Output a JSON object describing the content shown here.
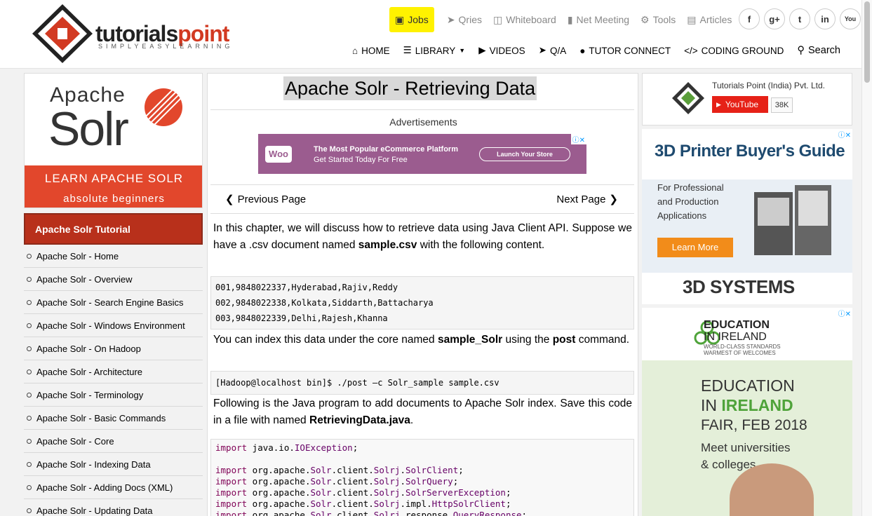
{
  "header": {
    "logo_word_a": "tutorials",
    "logo_word_b": "point",
    "logo_tagline": "SIMPLYEASYLEARNING",
    "top_links": {
      "jobs": "Jobs",
      "qries": "Qries",
      "whiteboard": "Whiteboard",
      "meeting": "Net Meeting",
      "tools": "Tools",
      "articles": "Articles"
    },
    "social": {
      "facebook": "f",
      "google": "g+",
      "twitter": "t",
      "linkedin": "in",
      "youtube": "You"
    },
    "nav": {
      "home": "HOME",
      "library": "LIBRARY",
      "videos": "VIDEOS",
      "qa": "Q/A",
      "tutor": "TUTOR CONNECT",
      "coding": "CODING GROUND",
      "search": "Search"
    }
  },
  "left": {
    "banner": {
      "apache": "Apache",
      "solr": "Solr",
      "learn": "LEARN APACHE SOLR",
      "absolute": "absolute beginners"
    },
    "heading": "Apache Solr Tutorial",
    "items": [
      "Apache Solr - Home",
      "Apache Solr - Overview",
      "Apache Solr - Search Engine Basics",
      "Apache Solr - Windows Environment",
      "Apache Solr - On Hadoop",
      "Apache Solr - Architecture",
      "Apache Solr - Terminology",
      "Apache Solr - Basic Commands",
      "Apache Solr - Core",
      "Apache Solr - Indexing Data",
      "Apache Solr - Adding Docs (XML)",
      "Apache Solr - Updating Data"
    ]
  },
  "main": {
    "title": "Apache Solr - Retrieving Data",
    "advertisements": "Advertisements",
    "ad": {
      "woo": "Woo",
      "line1": "The Most Popular eCommerce Platform",
      "line2": "Get Started Today For Free",
      "button": "Launch Your Store"
    },
    "prev": "Previous Page",
    "next": "Next Page",
    "p1": {
      "a": "In this chapter, we will discuss how to retrieve data using Java Client API. Suppose we have a .csv document named ",
      "b": "sample.csv",
      "c": " with the following content."
    },
    "csv": [
      "001,9848022337,Hyderabad,Rajiv,Reddy",
      "002,9848022338,Kolkata,Siddarth,Battacharya",
      "003,9848022339,Delhi,Rajesh,Khanna"
    ],
    "p2": {
      "a": "You can index this data under the core named ",
      "b": "sample_Solr",
      "c": " using the ",
      "d": "post",
      "e": " command."
    },
    "cmd": "[Hadoop@localhost bin]$ ./post –c Solr_sample sample.csv",
    "p3": {
      "a": "Following is the Java program to add documents to Apache Solr index. Save this code in a file with named ",
      "b": "RetrievingData.java",
      "c": "."
    },
    "java": [
      {
        "kw": "import",
        "rest": " java.io.",
        "cls": "IOException",
        "end": ";"
      },
      {
        "kw": "",
        "rest": "",
        "cls": "",
        "end": ""
      },
      {
        "kw": "import",
        "rest": " org.apache.",
        "cls": "Solr",
        "end": ".client.",
        "cls2": "Solrj",
        "end2": ".",
        "cls3": "SolrClient",
        "end3": ";"
      },
      {
        "kw": "import",
        "rest": " org.apache.",
        "cls": "Solr",
        "end": ".client.",
        "cls2": "Solrj",
        "end2": ".",
        "cls3": "SolrQuery",
        "end3": ";"
      },
      {
        "kw": "import",
        "rest": " org.apache.",
        "cls": "Solr",
        "end": ".client.",
        "cls2": "Solrj",
        "end2": ".",
        "cls3": "SolrServerException",
        "end3": ";"
      },
      {
        "kw": "import",
        "rest": " org.apache.",
        "cls": "Solr",
        "end": ".client.",
        "cls2": "Solrj",
        "end2": ".impl.",
        "cls3": "HttpSolrClient",
        "end3": ";"
      },
      {
        "kw": "import",
        "rest": " org.apache.",
        "cls": "Solr",
        "end": ".client.",
        "cls2": "Solrj",
        "end2": ".response.",
        "cls3": "QueryResponse",
        "end3": ";"
      }
    ]
  },
  "right": {
    "yt": {
      "name": "Tutorials Point (India) Pvt. Ltd.",
      "button": "YouTube",
      "count": "38K"
    },
    "ad3d": {
      "headline": "3D Printer Buyer's Guide",
      "sub1": "For Professional",
      "sub2": "and Production",
      "sub3": "Applications",
      "cta": "Learn More",
      "brand": "3D SYSTEMS"
    },
    "edu": {
      "t1": "EDUCATION",
      "t2": "IN IRELAND",
      "t3": "WORLD-CLASS STANDARDS",
      "t4": "WARMEST OF WELCOMES",
      "b1": "EDUCATION",
      "b2a": "IN ",
      "b2b": "IRELAND",
      "b3": "FAIR, FEB 2018",
      "b4": "Meet universities",
      "b5": "& colleges"
    }
  },
  "colors": {
    "accent": "#d23a22",
    "sidebar_head": "#b8301b",
    "jobs": "#fff200"
  }
}
